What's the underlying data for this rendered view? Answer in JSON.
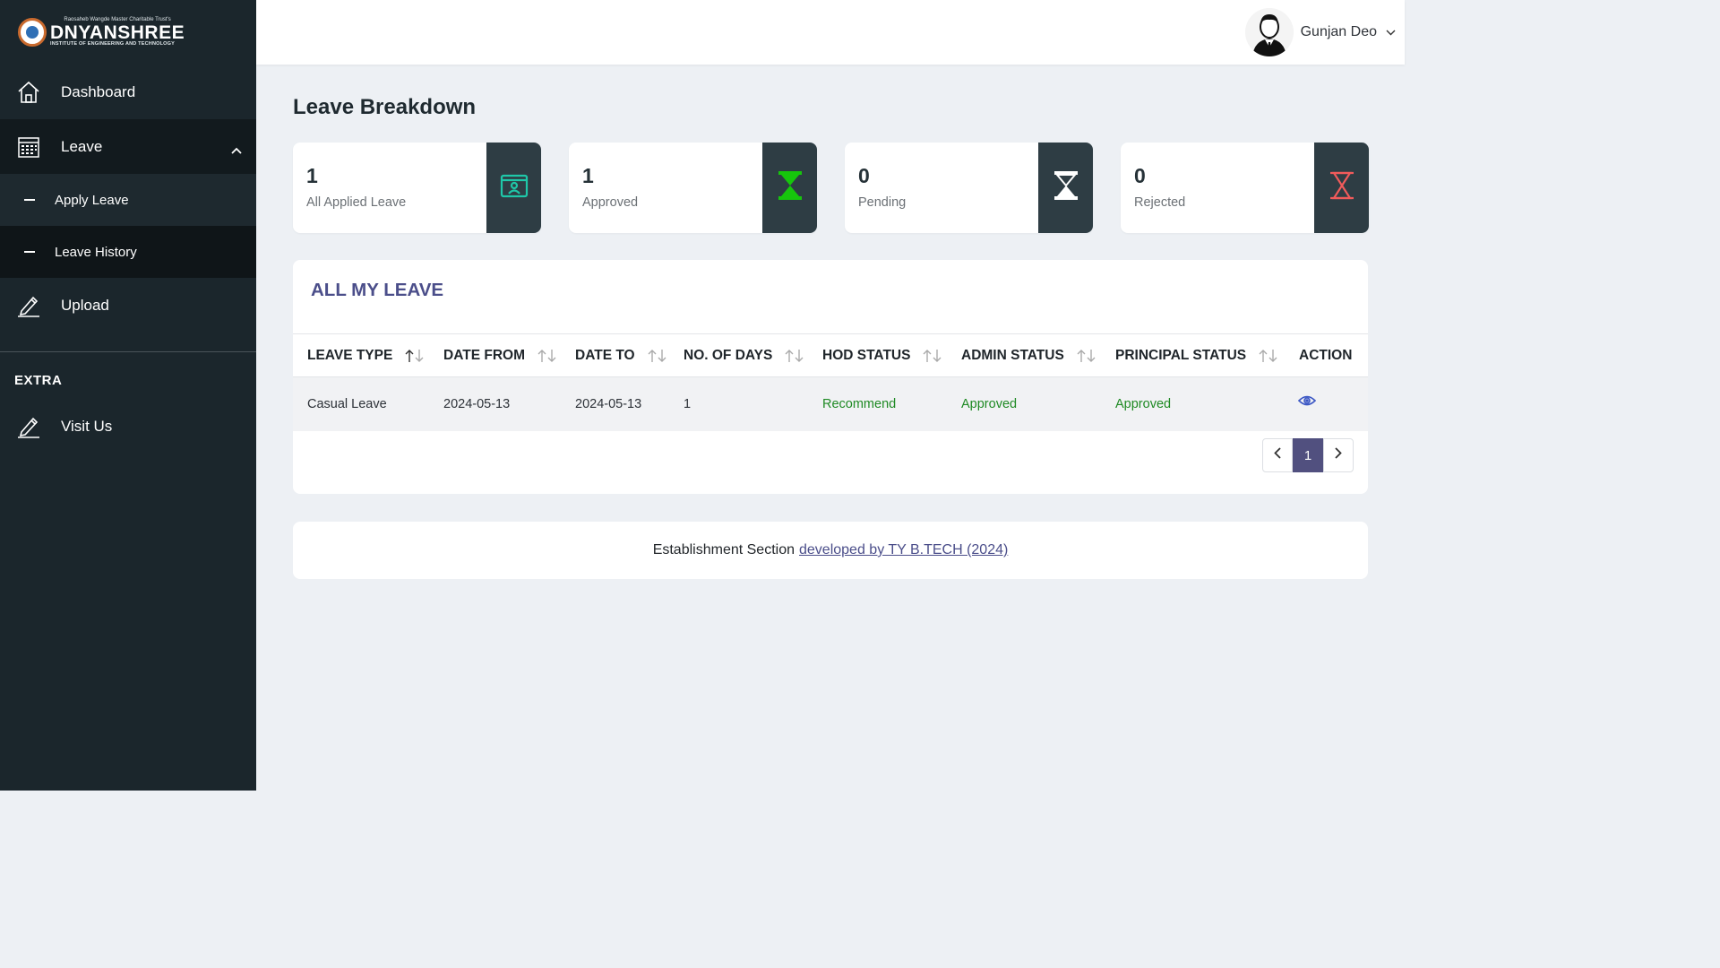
{
  "brand": {
    "trust": "Raosaheb Wangde Master Charitable Trust's",
    "name": "DNYANSHREE",
    "sub": "INSTITUTE OF ENGINEERING AND TECHNOLOGY"
  },
  "sidebar": {
    "items": [
      {
        "label": "Dashboard",
        "icon": "home-icon"
      },
      {
        "label": "Leave",
        "icon": "calendar-grid-icon"
      },
      {
        "label": "Upload",
        "icon": "pencil-icon"
      }
    ],
    "leave_sub": [
      {
        "label": "Apply Leave"
      },
      {
        "label": "Leave History"
      }
    ],
    "section_label": "EXTRA",
    "extra_item": {
      "label": "Visit Us",
      "icon": "pencil-icon"
    }
  },
  "topbar": {
    "user_name": "Gunjan Deo"
  },
  "page_title": "Leave Breakdown",
  "cards": [
    {
      "count": "1",
      "label": "All Applied Leave",
      "icon": "id-card-icon",
      "icon_color": "#1fc7a8"
    },
    {
      "count": "1",
      "label": "Approved",
      "icon": "hourglass-full-icon",
      "icon_color": "#16c60c"
    },
    {
      "count": "0",
      "label": "Pending",
      "icon": "hourglass-half-icon",
      "icon_color": "#ffffff"
    },
    {
      "count": "0",
      "label": "Rejected",
      "icon": "hourglass-empty-icon",
      "icon_color": "#f15b5b"
    }
  ],
  "table": {
    "title": "ALL MY LEAVE",
    "headers": [
      "LEAVE TYPE",
      "DATE FROM",
      "DATE TO",
      "NO. OF DAYS",
      "HOD STATUS",
      "ADMIN STATUS",
      "PRINCIPAL STATUS",
      "ACTION"
    ],
    "rows": [
      {
        "leave_type": "Casual Leave",
        "date_from": "2024-05-13",
        "date_to": "2024-05-13",
        "days": "1",
        "hod_status": "Recommend",
        "admin_status": "Approved",
        "principal_status": "Approved"
      }
    ],
    "pagination": {
      "current": "1"
    }
  },
  "footer": {
    "text": "Establishment Section",
    "link": "developed by TY B.TECH (2024)"
  },
  "colors": {
    "sidebar_bg": "#1b262c",
    "accent": "#4b4e8a",
    "status_green": "#1f8a24"
  }
}
